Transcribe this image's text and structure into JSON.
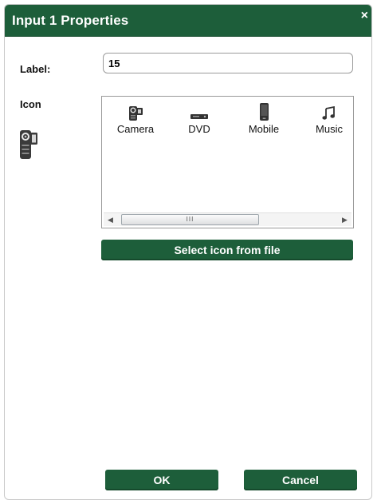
{
  "dialog": {
    "title": "Input 1 Properties",
    "close_glyph": "×"
  },
  "form": {
    "label_caption": "Label:",
    "label_value": "15",
    "icon_caption": "Icon"
  },
  "icon_list": {
    "items": [
      {
        "name": "Camera",
        "icon": "camera-icon"
      },
      {
        "name": "DVD",
        "icon": "dvd-icon"
      },
      {
        "name": "Mobile",
        "icon": "mobile-icon"
      },
      {
        "name": "Music",
        "icon": "music-icon"
      }
    ],
    "scroll_left": "◀",
    "scroll_right": "▶",
    "thumb_grip": "III"
  },
  "buttons": {
    "select_icon_label": "Select icon from file",
    "ok_label": "OK",
    "cancel_label": "Cancel"
  },
  "colors": {
    "brand_green": "#1d5e3a",
    "text_white": "#ffffff"
  }
}
